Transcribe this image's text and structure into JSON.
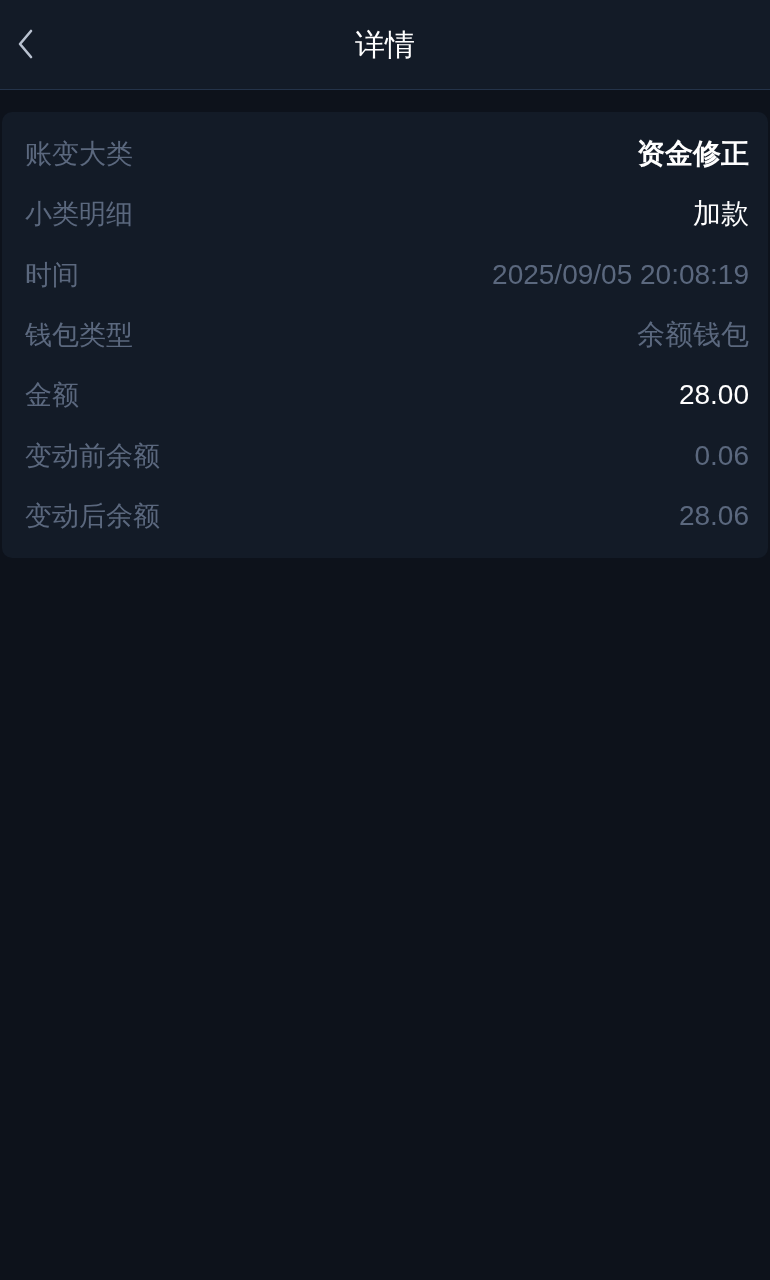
{
  "header": {
    "title": "详情"
  },
  "details": [
    {
      "label": "账变大类",
      "value": "资金修正",
      "bold": true,
      "muted": false
    },
    {
      "label": "小类明细",
      "value": "加款",
      "bold": false,
      "muted": false
    },
    {
      "label": "时间",
      "value": "2025/09/05 20:08:19",
      "bold": false,
      "muted": true
    },
    {
      "label": "钱包类型",
      "value": "余额钱包",
      "bold": false,
      "muted": true
    },
    {
      "label": "金额",
      "value": "28.00",
      "bold": false,
      "muted": false
    },
    {
      "label": "变动前余额",
      "value": "0.06",
      "bold": false,
      "muted": true
    },
    {
      "label": "变动后余额",
      "value": "28.06",
      "bold": false,
      "muted": true
    }
  ]
}
